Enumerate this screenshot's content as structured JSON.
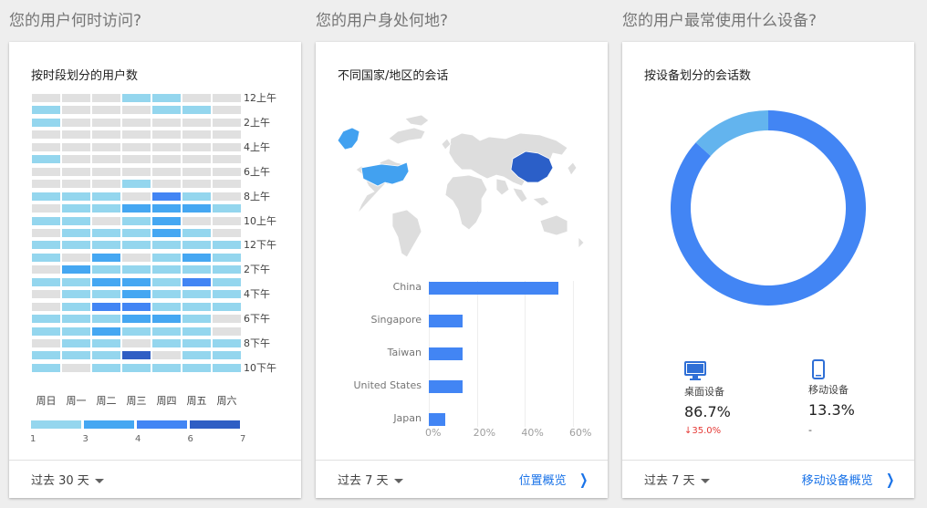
{
  "sections": {
    "when": "您的用户何时访问?",
    "where": "您的用户身处何地?",
    "devices": "您的用户最常使用什么设备?"
  },
  "heatmap_card": {
    "title": "按时段划分的用户数",
    "range_label": "过去 30 天"
  },
  "geo_card": {
    "title": "不同国家/地区的会话",
    "range_label": "过去 7 天",
    "link_label": "位置概览"
  },
  "device_card": {
    "title": "按设备划分的会话数",
    "range_label": "过去 7 天",
    "link_label": "移动设备概览",
    "desktop": {
      "label": "桌面设备",
      "value": "86.7%",
      "change": "35.0%"
    },
    "mobile": {
      "label": "移动设备",
      "value": "13.3%",
      "change": "-"
    }
  },
  "colors": {
    "empty": "#e0e0e0",
    "level1": "#94d6ee",
    "level2": "#45a7f2",
    "level3": "#4285f4",
    "level4": "#2f5ec4",
    "desktop": "#4285f4",
    "mobile": "#63b4ee",
    "highlight_china": "#2b5fc8",
    "highlight_us": "#42a1f0",
    "land": "#dddddd"
  },
  "chart_data": [
    {
      "type": "heatmap",
      "title": "按时段划分的用户数",
      "x": [
        "周日",
        "周一",
        "周二",
        "周三",
        "周四",
        "周五",
        "周六"
      ],
      "y_tick_labels": [
        "12上午",
        "2上午",
        "4上午",
        "6上午",
        "8上午",
        "10上午",
        "12下午",
        "2下午",
        "4下午",
        "6下午",
        "8下午",
        "10下午"
      ],
      "legend_labels": [
        "1",
        "3",
        "4",
        "6",
        "7"
      ],
      "values": [
        [
          0,
          0,
          0,
          1,
          1,
          0,
          0
        ],
        [
          1,
          0,
          0,
          0,
          1,
          1,
          0
        ],
        [
          1,
          0,
          0,
          0,
          0,
          0,
          0
        ],
        [
          0,
          0,
          0,
          0,
          0,
          0,
          0
        ],
        [
          0,
          0,
          0,
          0,
          0,
          0,
          0
        ],
        [
          1,
          0,
          0,
          0,
          0,
          0,
          0
        ],
        [
          0,
          0,
          0,
          0,
          0,
          0,
          0
        ],
        [
          0,
          0,
          0,
          1,
          0,
          0,
          0
        ],
        [
          1,
          1,
          1,
          0,
          3,
          1,
          0
        ],
        [
          0,
          1,
          1,
          2,
          2,
          2,
          1
        ],
        [
          1,
          1,
          0,
          1,
          2,
          0,
          0
        ],
        [
          0,
          1,
          1,
          1,
          2,
          1,
          0
        ],
        [
          1,
          1,
          1,
          1,
          1,
          1,
          1
        ],
        [
          1,
          0,
          2,
          0,
          1,
          2,
          1
        ],
        [
          0,
          2,
          1,
          1,
          1,
          1,
          1
        ],
        [
          1,
          1,
          2,
          2,
          1,
          3,
          1
        ],
        [
          0,
          1,
          1,
          2,
          1,
          1,
          1
        ],
        [
          0,
          1,
          3,
          3,
          1,
          1,
          1
        ],
        [
          1,
          1,
          1,
          2,
          2,
          1,
          0
        ],
        [
          1,
          1,
          2,
          1,
          1,
          1,
          0
        ],
        [
          0,
          1,
          1,
          0,
          1,
          1,
          1
        ],
        [
          1,
          1,
          1,
          4,
          0,
          1,
          1
        ],
        [
          1,
          0,
          1,
          1,
          1,
          1,
          1
        ]
      ]
    },
    {
      "type": "bar",
      "title": "不同国家/地区的会话",
      "categories": [
        "China",
        "Singapore",
        "Taiwan",
        "United States",
        "Japan"
      ],
      "values": [
        54,
        14,
        14,
        14,
        7
      ],
      "xlim": [
        0,
        60
      ],
      "x_tick_labels": [
        "0%",
        "20%",
        "40%",
        "60%"
      ]
    },
    {
      "type": "pie",
      "title": "按设备划分的会话数",
      "categories": [
        "桌面设备",
        "移动设备"
      ],
      "values": [
        86.7,
        13.3
      ]
    }
  ]
}
